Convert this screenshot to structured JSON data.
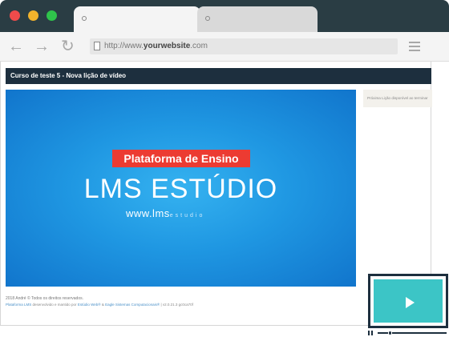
{
  "browser": {
    "url_prefix": "http://www.",
    "url_domain": "yourwebsite",
    "url_suffix": ".com",
    "window_controls": [
      "close-dot",
      "minimize-dot",
      "maximize-dot"
    ],
    "icons": [
      "back-arrow-icon",
      "forward-arrow-icon",
      "reload-icon",
      "page-icon",
      "menu-icon"
    ]
  },
  "course": {
    "header": "Curso de teste 5 - Nova lição de vídeo"
  },
  "video": {
    "badge": "Plataforma de Ensino",
    "headline": "LMS ESTÚDIO",
    "site_main": "www.lms",
    "site_faded": "estudio"
  },
  "sidebar": {
    "note": "Próxima Lição disponível ao terminar"
  },
  "footer": {
    "copyright": "2018 André © Todos os direitos reservados.",
    "platform_link": "Plataforma LMS",
    "credits_mid": " desenvolvido e mantido por ",
    "studio_link": "Estúdio Web®",
    "and": " & ",
    "eagle_link": "Eagle Sistemas Computacionais®",
    "version": " | v2.0.21.3 gc0ca70f"
  },
  "player_widget": {
    "progress": 0.18,
    "colors": {
      "screen": "#3cc5c6",
      "frame": "#1d2f3e"
    }
  },
  "colors": {
    "header_bg": "#1d2f3e",
    "badge_bg": "#ec3b32",
    "video_bg": "#1f97e2",
    "titlebar": "#2a3d44"
  }
}
